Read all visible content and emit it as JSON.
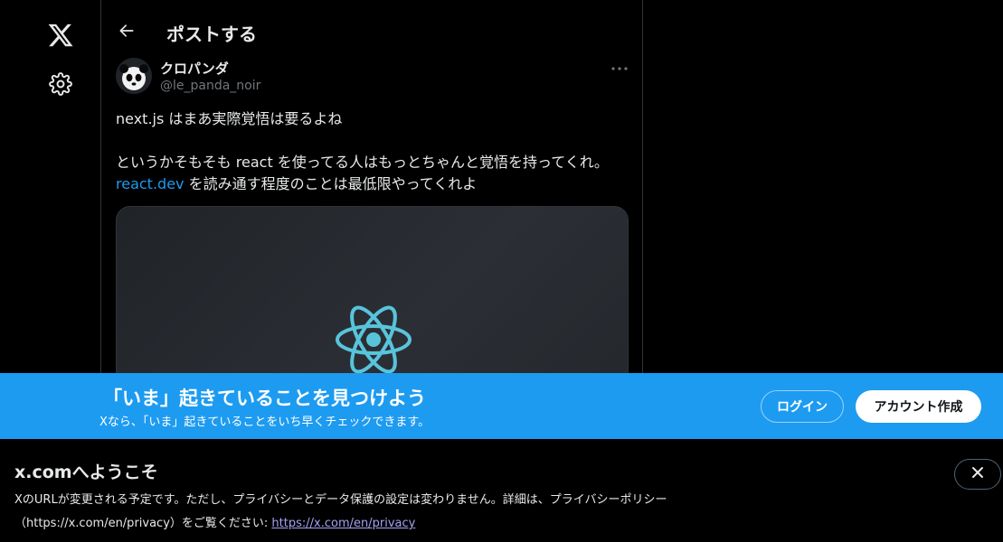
{
  "nav": {
    "logo_icon": "x-logo-icon",
    "settings_icon": "gear-icon"
  },
  "header": {
    "back_icon": "arrow-left-icon",
    "title": "ポストする"
  },
  "post": {
    "display_name": "クロパンダ",
    "handle": "@le_panda_noir",
    "more_icon": "ellipsis-icon",
    "text_line1": "next.js はまあ実際覚悟は要るよね",
    "text_line2": "というかそもそも react を使ってる人はもっとちゃんと覚悟を持ってくれ。",
    "link_text": "react.dev",
    "text_line3": " を読み通す程度のことは最低限やってくれよ",
    "media_icon": "react-logo-icon"
  },
  "banner": {
    "title": "「いま」起きていることを見つけよう",
    "subtitle": "Xなら、「いま」起きていることをいち早くチェックできます。",
    "login_label": "ログイン",
    "signup_label": "アカウント作成"
  },
  "notice": {
    "title": "x.comへようこそ",
    "body": "XのURLが変更される予定です。ただし、プライバシーとデータ保護の設定は変わりません。詳細は、プライバシーポリシー（https://x.com/en/privacy）をご覧ください: ",
    "link": "https://x.com/en/privacy",
    "close_icon": "close-icon"
  },
  "colors": {
    "accent": "#1d9bf0",
    "background": "#000000",
    "react": "#58c4dc"
  }
}
